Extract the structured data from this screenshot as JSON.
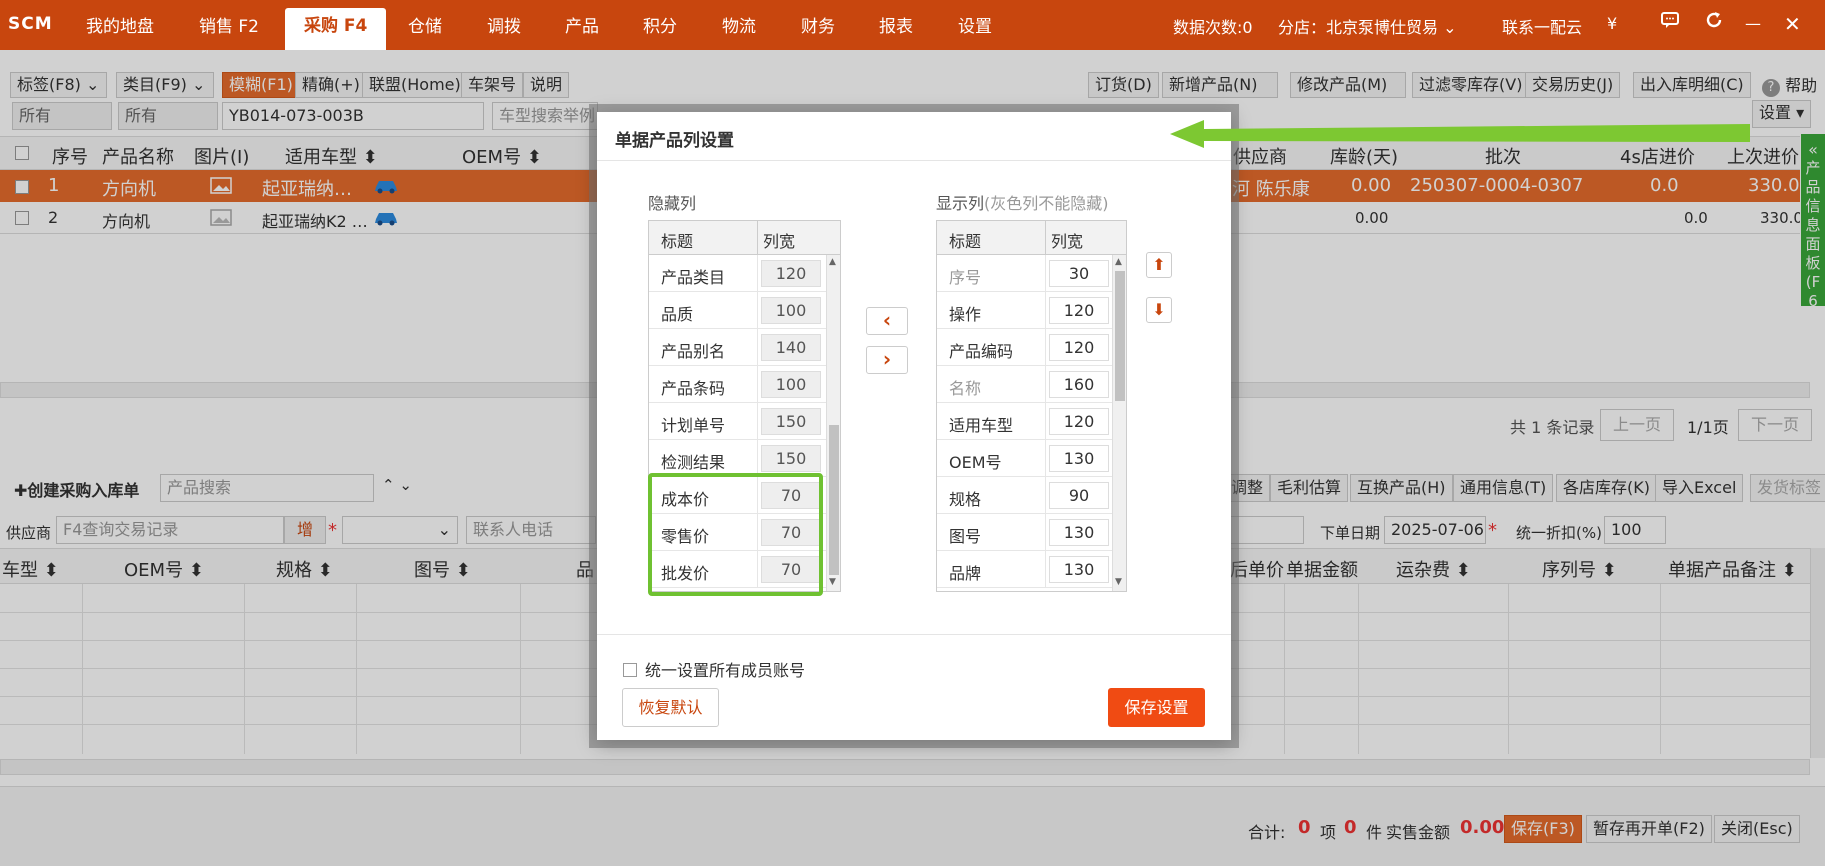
{
  "topbar": {
    "brand": "SCM",
    "tabs": [
      "我的地盘",
      "销售 F2",
      "采购 F4",
      "仓储",
      "调拨",
      "产品",
      "积分",
      "物流",
      "财务",
      "报表",
      "设置"
    ],
    "active_tab": "采购 F4",
    "data_count": "数据次数:0",
    "branch": "分店：北京泵博仕贸易",
    "contact": "联系一配云",
    "yen": "¥",
    "minimize": "—",
    "close": "✕"
  },
  "toolbar": {
    "tag": "标签(F8)",
    "category": "类目(F9)",
    "fuzzy": "模糊(F1)",
    "exact": "精确(+)",
    "union": "联盟(Home)",
    "shelf": "车架号",
    "explain": "说明",
    "all1": "所有",
    "all2": "所有",
    "search_value": "YB014-073-003B",
    "car_search_placeholder": "车型搜索举例",
    "order": "订货(D)",
    "new_product": "新增产品(N)",
    "edit_product": "修改产品(M)",
    "filter_zero": "过滤零库存(V)",
    "history": "交易历史(J)",
    "inout": "出入库明细(C)",
    "help": "帮助",
    "settings": "设置"
  },
  "grid": {
    "headers": [
      "序号",
      "产品名称",
      "图片(I)",
      "适用车型",
      "OEM号",
      "供应商",
      "库龄(天)",
      "批次",
      "4s店进价",
      "上次进价"
    ],
    "rows": [
      {
        "no": "1",
        "name": "方向机",
        "car": "起亚瑞纳…",
        "supplier": "河 陈乐康",
        "age": "0.00",
        "batch": "250307-0004-0307",
        "price4s": "0.0",
        "last": "330.0"
      },
      {
        "no": "2",
        "name": "方向机",
        "car": "起亚瑞纳K2 …",
        "supplier": "",
        "age": "0.00",
        "batch": "",
        "price4s": "0.0",
        "last": "330.0"
      }
    ],
    "total": "共 1 条记录",
    "prev": "上一页",
    "page": "1/1页",
    "next": "下一页"
  },
  "side_panel": {
    "label": "产品信息面板(F6"
  },
  "lower": {
    "create": "✚创建采购入库单",
    "product_search": "产品搜索",
    "adjust": "调整",
    "profit": "毛利估算",
    "swap": "互换产品(H)",
    "general": "通用信息(T)",
    "stock": "各店库存(K)",
    "import": "导入Excel",
    "send_tag": "发货标签",
    "supplier_label": "供应商",
    "supplier_placeholder": "F4查询交易记录",
    "add": "增",
    "contact_phone": "联系人电话",
    "order_date_label": "下单日期",
    "order_date": "2025-07-06",
    "discount_label": "统一折扣(%)",
    "discount": "100",
    "headers": [
      "车型",
      "OEM号",
      "规格",
      "图号",
      "品",
      "后单价",
      "单据金额",
      "运杂费",
      "序列号",
      "单据产品备注"
    ]
  },
  "footer": {
    "total_label": "合计:",
    "items": "0",
    "items_unit": "项",
    "pieces": "0",
    "pieces_unit": "件",
    "amount_label": "实售金额",
    "amount": "0.00",
    "save": "保存(F3)",
    "hold": "暂存再开单(F2)",
    "close": "关闭(Esc)"
  },
  "dialog": {
    "title": "单据产品列设置",
    "hidden_label": "隐藏列",
    "shown_label": "显示列",
    "shown_note": "(灰色列不能隐藏)",
    "col_title": "标题",
    "col_width": "列宽",
    "hidden_rows": [
      {
        "title": "产品类目",
        "width": "120"
      },
      {
        "title": "品质",
        "width": "100"
      },
      {
        "title": "产品别名",
        "width": "140"
      },
      {
        "title": "产品条码",
        "width": "100"
      },
      {
        "title": "计划单号",
        "width": "150"
      },
      {
        "title": "检测结果",
        "width": "150"
      },
      {
        "title": "成本价",
        "width": "70"
      },
      {
        "title": "零售价",
        "width": "70"
      },
      {
        "title": "批发价",
        "width": "70"
      }
    ],
    "shown_rows": [
      {
        "title": "序号",
        "width": "30",
        "locked": true
      },
      {
        "title": "操作",
        "width": "120",
        "locked": false
      },
      {
        "title": "产品编码",
        "width": "120",
        "locked": false
      },
      {
        "title": "名称",
        "width": "160",
        "locked": true
      },
      {
        "title": "适用车型",
        "width": "120",
        "locked": false
      },
      {
        "title": "OEM号",
        "width": "130",
        "locked": false
      },
      {
        "title": "规格",
        "width": "90",
        "locked": false
      },
      {
        "title": "图号",
        "width": "130",
        "locked": false
      },
      {
        "title": "品牌",
        "width": "130",
        "locked": false
      }
    ],
    "move_left": "‹",
    "move_right": "›",
    "move_up": "⬆",
    "move_down": "⬇",
    "unify_label": "统一设置所有成员账号",
    "restore": "恢复默认",
    "save": "保存设置"
  },
  "colors": {
    "brand": "#c8460e",
    "accent": "#e66c2c",
    "highlight": "#6fc131"
  }
}
